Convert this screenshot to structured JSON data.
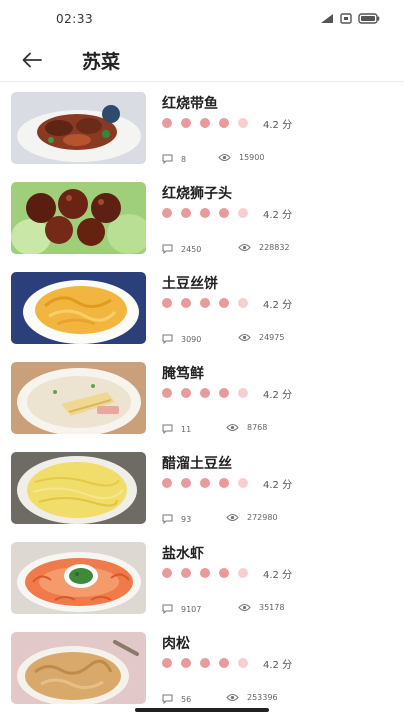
{
  "status_bar": {
    "time": "02:33",
    "icons": [
      "signal-icon",
      "sim-icon",
      "battery-icon"
    ]
  },
  "app_bar": {
    "back_icon": "arrow-left-icon",
    "title": "苏菜"
  },
  "recipes": [
    {
      "name": "红烧带鱼",
      "rating_dots": 5,
      "score": "4.2 分",
      "comments": "8",
      "views": "15900"
    },
    {
      "name": "红烧狮子头",
      "rating_dots": 5,
      "score": "4.2 分",
      "comments": "2450",
      "views": "228832"
    },
    {
      "name": "土豆丝饼",
      "rating_dots": 5,
      "score": "4.2 分",
      "comments": "3090",
      "views": "24975"
    },
    {
      "name": "腌笃鲜",
      "rating_dots": 5,
      "score": "4.2 分",
      "comments": "11",
      "views": "8768"
    },
    {
      "name": "醋溜土豆丝",
      "rating_dots": 5,
      "score": "4.2 分",
      "comments": "93",
      "views": "272980"
    },
    {
      "name": "盐水虾",
      "rating_dots": 5,
      "score": "4.2 分",
      "comments": "9107",
      "views": "35178"
    },
    {
      "name": "肉松",
      "rating_dots": 5,
      "score": "4.2 分",
      "comments": "56",
      "views": "253396"
    }
  ],
  "colors": {
    "rating_dot": "#e99a9c",
    "rating_dot_light": "#f6cfd0",
    "divider": "#ececec"
  }
}
